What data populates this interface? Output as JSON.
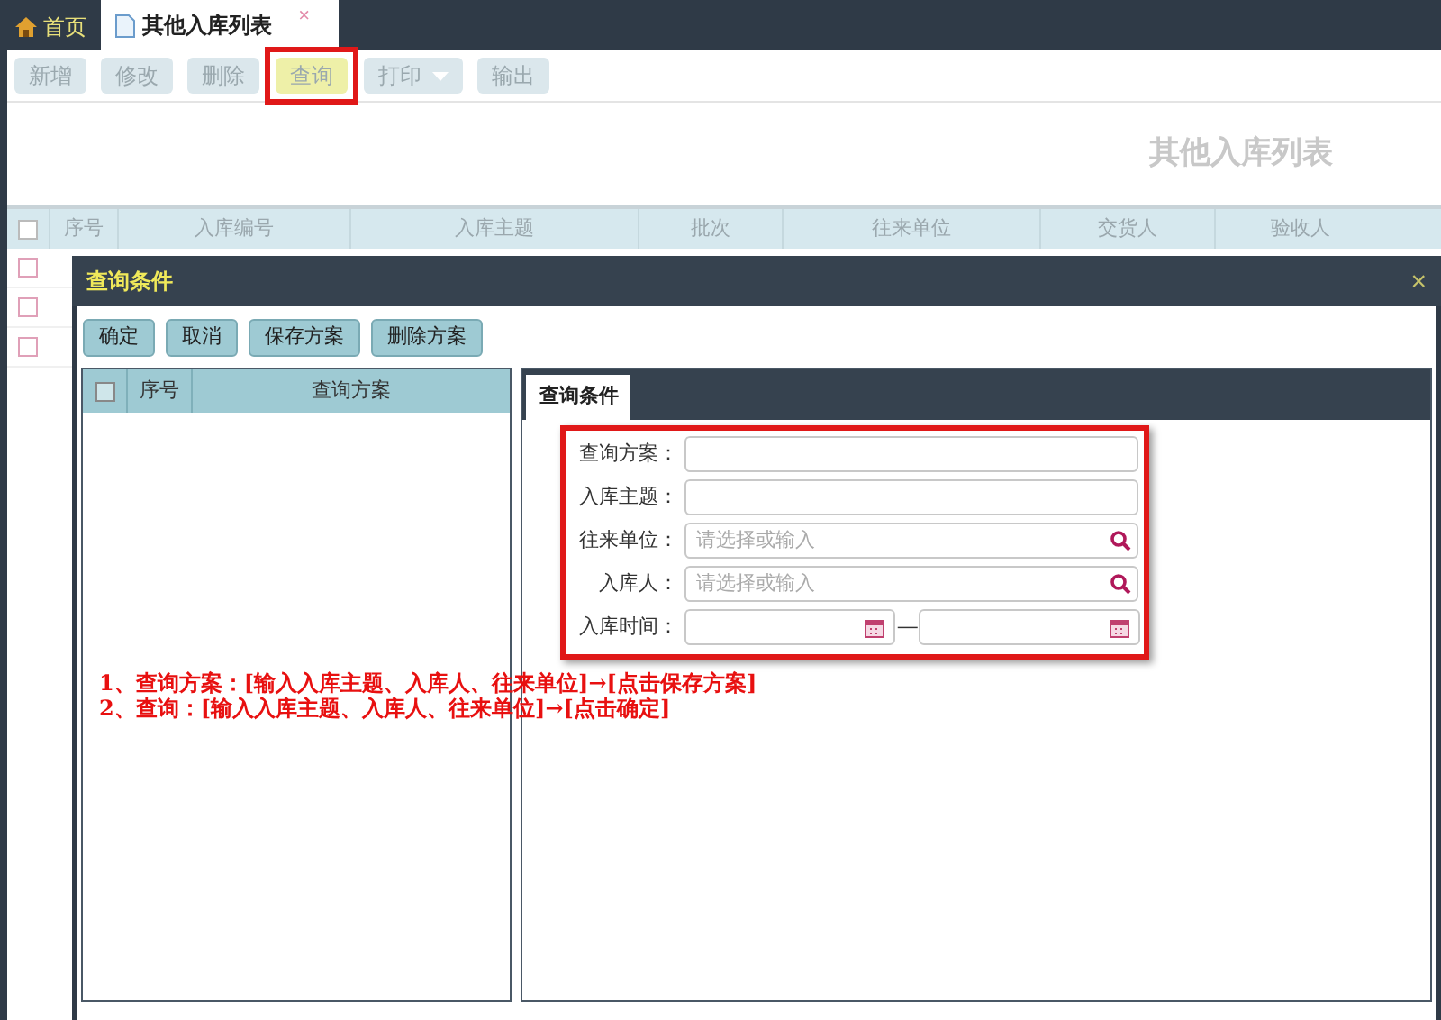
{
  "tabs": [
    {
      "label": "首页",
      "kind": "home",
      "selected": false
    },
    {
      "label": "其他入库列表",
      "kind": "page",
      "selected": true,
      "close": "×"
    }
  ],
  "toolbar": [
    {
      "label": "新增",
      "kind": "plain",
      "highlighted": false
    },
    {
      "label": "修改",
      "kind": "plain",
      "highlighted": false
    },
    {
      "label": "删除",
      "kind": "plain",
      "highlighted": false
    },
    {
      "label": "查询",
      "kind": "plain",
      "highlighted": true
    },
    {
      "label": "打印",
      "kind": "dropdown",
      "highlighted": false
    },
    {
      "label": "输出",
      "kind": "plain",
      "highlighted": false
    }
  ],
  "page_title": "其他入库列表",
  "table": {
    "columns": [
      "序号",
      "入库编号",
      "入库主题",
      "批次",
      "往来单位",
      "交货人",
      "验收人"
    ],
    "all_checked": false,
    "rows": [
      {
        "checked": false
      },
      {
        "checked": false
      },
      {
        "checked": false
      }
    ]
  },
  "dialog": {
    "title": "查询条件",
    "close": "×",
    "buttons": [
      "确定",
      "取消",
      "保存方案",
      "删除方案"
    ],
    "plans": {
      "all_checked": false,
      "columns": [
        "序号",
        "查询方案"
      ]
    },
    "tabs": [
      {
        "label": "查询条件",
        "selected": true
      }
    ],
    "fields": [
      {
        "label": "查询方案：",
        "kind": "text"
      },
      {
        "label": "入库主题：",
        "kind": "text"
      },
      {
        "label": "往来单位：",
        "kind": "search",
        "placeholder": "请选择或输入"
      },
      {
        "label": "入库人：",
        "kind": "search",
        "placeholder": "请选择或输入"
      },
      {
        "label": "入库时间：",
        "kind": "daterange",
        "separator": "—"
      }
    ],
    "notes": [
      "1、查询方案：[输入入库主题、入库人、往来单位]→[点击保存方案]",
      "2、查询：[输入入库主题、入库人、往来单位]→[点击确定]"
    ]
  }
}
